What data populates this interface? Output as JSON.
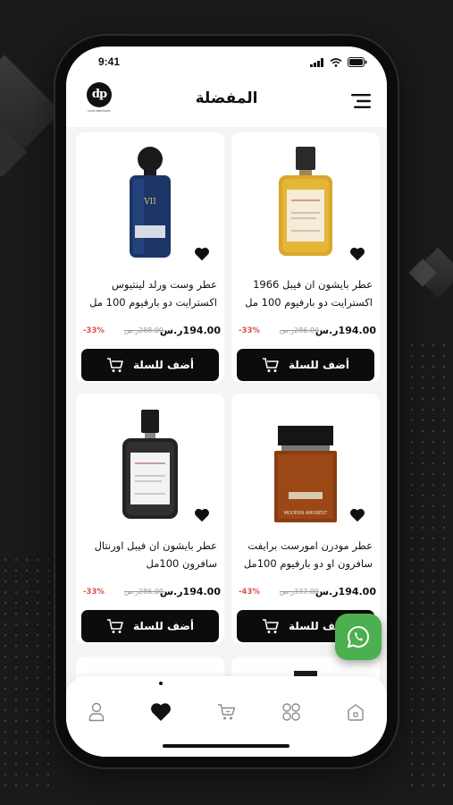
{
  "status_bar": {
    "time": "9:41"
  },
  "header": {
    "title": "المفضلة",
    "logo_text": "dp",
    "logo_subtitle": "DOSE PERFUMES"
  },
  "products": [
    {
      "name": "عطر بايشون ان فيبل 1966 اكسترايت دو بارفيوم 100 مل",
      "price": "194.00ر.س",
      "old_price": "286.00ر.س",
      "discount": "-33%",
      "add_label": "أضف للسلة",
      "bottle_style": "amber-classic"
    },
    {
      "name": "عطر وست ورلد لينتيوس اكسترايت دو بارفيوم 100 مل",
      "price": "194.00ر.س",
      "old_price": "288.00ر.س",
      "discount": "-33%",
      "add_label": "أضف للسلة",
      "bottle_style": "blue-vii"
    },
    {
      "name": "عطر مودرن امورست  برايفت سافرون او دو بارفيوم 100مل",
      "price": "194.00ر.س",
      "old_price": "337.00ر.س",
      "discount": "-43%",
      "add_label": "أضف للسلة",
      "bottle_style": "amber-square"
    },
    {
      "name": "عطر بايشون ان فيبل اورنتال سافرون 100مل",
      "price": "194.00ر.س",
      "old_price": "286.00ر.س",
      "discount": "-33%",
      "add_label": "أضف للسلة",
      "bottle_style": "dark-classic"
    }
  ],
  "bottom_nav": {
    "items": [
      "home-icon",
      "categories-icon",
      "cart-icon",
      "favorites-icon",
      "profile-icon"
    ],
    "active": "favorites-icon"
  },
  "colors": {
    "accent": "#0c0c0c",
    "discount": "#d9534f",
    "whatsapp": "#4caf50",
    "background": "#1a1a1a"
  }
}
